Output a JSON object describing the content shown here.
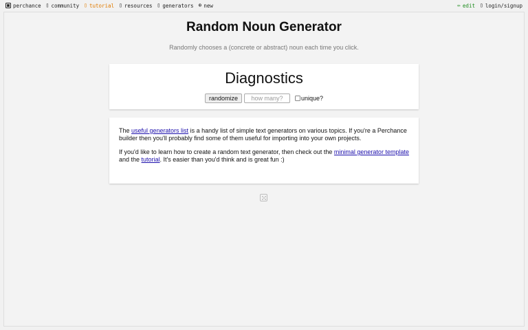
{
  "nav": {
    "left": [
      {
        "label": "perchance",
        "icon": "die-icon"
      },
      {
        "label": "community",
        "icon": "chat-icon",
        "glyph": "▯"
      },
      {
        "label": "tutorial",
        "icon": "book-icon",
        "glyph": "▯"
      },
      {
        "label": "resources",
        "icon": "folder-icon",
        "glyph": "▯"
      },
      {
        "label": "generators",
        "icon": "grid-icon",
        "glyph": "▯"
      },
      {
        "label": "new",
        "icon": "plus-circle-icon",
        "glyph": "⊕"
      }
    ],
    "right": [
      {
        "label": "edit",
        "icon": "pencil-icon",
        "glyph": "✏"
      },
      {
        "label": "login/signup",
        "icon": "user-icon",
        "glyph": "▯"
      }
    ]
  },
  "page": {
    "title": "Random Noun Generator",
    "subtitle": "Randomly chooses a (concrete or abstract) noun each time you click."
  },
  "output": {
    "value": "Diagnostics"
  },
  "controls": {
    "randomize_label": "randomize",
    "count_placeholder": "how many?",
    "unique_label": "unique?"
  },
  "info": {
    "p1": {
      "before": "The ",
      "link": "useful generators list",
      "after": " is a handy list of simple text generators on various topics. If you're a Perchance builder then you'll probably find some of them useful for importing into your own projects."
    },
    "p2": {
      "before": "If you'd like to learn how to create a random text generator, then check out the ",
      "link1": "minimal generator template",
      "middle": " and the ",
      "link2": "tutorial",
      "after": ". It's easier than you'd think and is great fun :)"
    }
  },
  "colors": {
    "tutorial": "#e07b00",
    "edit": "#1e8c1e",
    "link": "#1a0dab"
  }
}
